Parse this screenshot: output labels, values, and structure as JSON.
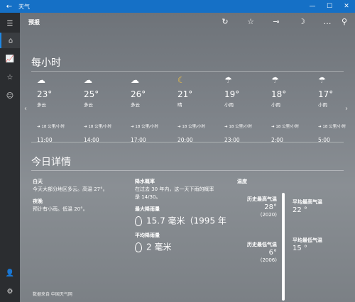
{
  "titlebar": {
    "title": "天气"
  },
  "topbar": {
    "forecast": "预报"
  },
  "hourly": {
    "title": "每小时",
    "items": [
      {
        "temp": "23°",
        "cond": "多云",
        "wind": "18 公里/小时",
        "time": "11:00",
        "icon": "cloud-icon"
      },
      {
        "temp": "25°",
        "cond": "多云",
        "wind": "18 公里/小时",
        "time": "14:00",
        "icon": "cloud-icon"
      },
      {
        "temp": "26°",
        "cond": "多云",
        "wind": "18 公里/小时",
        "time": "17:00",
        "icon": "cloud-icon"
      },
      {
        "temp": "21°",
        "cond": "晴",
        "wind": "18 公里/小时",
        "time": "20:00",
        "icon": "moon-icon"
      },
      {
        "temp": "19°",
        "cond": "小雨",
        "wind": "18 公里/小时",
        "time": "23:00",
        "icon": "rain-icon"
      },
      {
        "temp": "18°",
        "cond": "小雨",
        "wind": "18 公里/小时",
        "time": "2:00",
        "icon": "rain-icon"
      },
      {
        "temp": "17°",
        "cond": "小雨",
        "wind": "18 公里/小时",
        "time": "5:00",
        "icon": "rain-icon"
      }
    ]
  },
  "details": {
    "title": "今日详情",
    "day_label": "白天",
    "day_text": "今天大部分地区多云。高温 27°。",
    "night_label": "夜晚",
    "night_text": "预计有小雨。低温 20°。",
    "precip_label": "降水概率",
    "precip_text1": "在过去 30 年内，这一天下雨的概率",
    "precip_text2": "是 14/30。",
    "max_rain_label": "最大降雨量",
    "max_rain_value": "15.7 毫米（1995 年",
    "avg_rain_label": "平均降雨量",
    "avg_rain_value": "2 毫米",
    "temp_label": "温度",
    "hist_high_label": "历史最高气温",
    "hist_high_value": "28°",
    "hist_high_year": "(2020)",
    "avg_high_label": "平均最高气温",
    "avg_high_value": "22 °",
    "hist_low_label": "历史最低气温",
    "hist_low_value": "6°",
    "hist_low_year": "(2006)",
    "avg_low_label": "平均最低气温",
    "avg_low_value": "15 °"
  },
  "footer": {
    "source": "数据来自 中国天气网"
  }
}
